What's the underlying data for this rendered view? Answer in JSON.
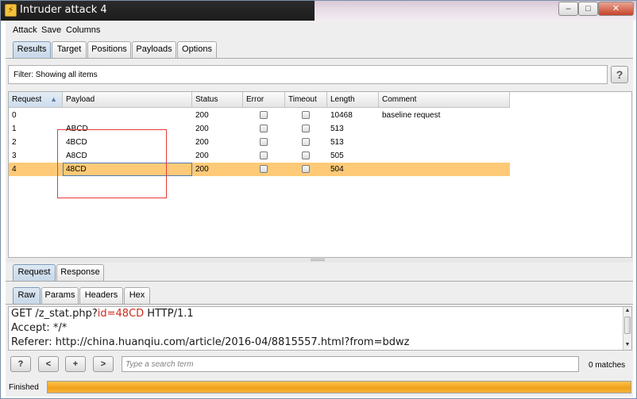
{
  "window": {
    "title": "Intruder attack 4",
    "minimize_glyph": "–",
    "maximize_glyph": "□",
    "close_glyph": "✕",
    "app_icon": "intruder-lightning-icon"
  },
  "menu": {
    "items": [
      "Attack",
      "Save",
      "Columns"
    ]
  },
  "main_tabs": {
    "items": [
      "Results",
      "Target",
      "Positions",
      "Payloads",
      "Options"
    ],
    "active": "Results"
  },
  "filter": {
    "text": "Filter:  Showing all items"
  },
  "help_glyph": "?",
  "table": {
    "columns": [
      "Request",
      "Payload",
      "Status",
      "Error",
      "Timeout",
      "Length",
      "Comment"
    ],
    "sort_indicator": "▲",
    "rows": [
      {
        "request": "0",
        "payload": "",
        "status": "200",
        "error": false,
        "timeout": false,
        "length": "10468",
        "comment": "baseline request",
        "selected": false
      },
      {
        "request": "1",
        "payload": "ABCD",
        "status": "200",
        "error": false,
        "timeout": false,
        "length": "513",
        "comment": "",
        "selected": false
      },
      {
        "request": "2",
        "payload": "4BCD",
        "status": "200",
        "error": false,
        "timeout": false,
        "length": "513",
        "comment": "",
        "selected": false
      },
      {
        "request": "3",
        "payload": "A8CD",
        "status": "200",
        "error": false,
        "timeout": false,
        "length": "505",
        "comment": "",
        "selected": false
      },
      {
        "request": "4",
        "payload": "48CD",
        "status": "200",
        "error": false,
        "timeout": false,
        "length": "504",
        "comment": "",
        "selected": true
      }
    ],
    "selected_color": "#ffca78"
  },
  "detail_tabs": {
    "items": [
      "Request",
      "Response"
    ],
    "active": "Request"
  },
  "view_tabs": {
    "items": [
      "Raw",
      "Params",
      "Headers",
      "Hex"
    ],
    "active": "Raw"
  },
  "request_text": {
    "line1_prefix": "GET /z_stat.php?",
    "line1_param": "id=48CD",
    "line1_suffix": " HTTP/1.1",
    "line2": "Accept: */*",
    "line3": "Referer: http://china.huanqiu.com/article/2016-04/8815557.html?from=bdwz"
  },
  "search": {
    "help_label": "?",
    "prev_label": "<",
    "add_label": "+",
    "next_label": ">",
    "placeholder": "Type a search term",
    "matches": "0 matches"
  },
  "status": {
    "text": "Finished",
    "progress_fraction": 1.0,
    "progress_color": "#f0a21a"
  },
  "colors": {
    "highlight_param": "#cc2a1f",
    "annotation_box": "#e53a3a"
  }
}
